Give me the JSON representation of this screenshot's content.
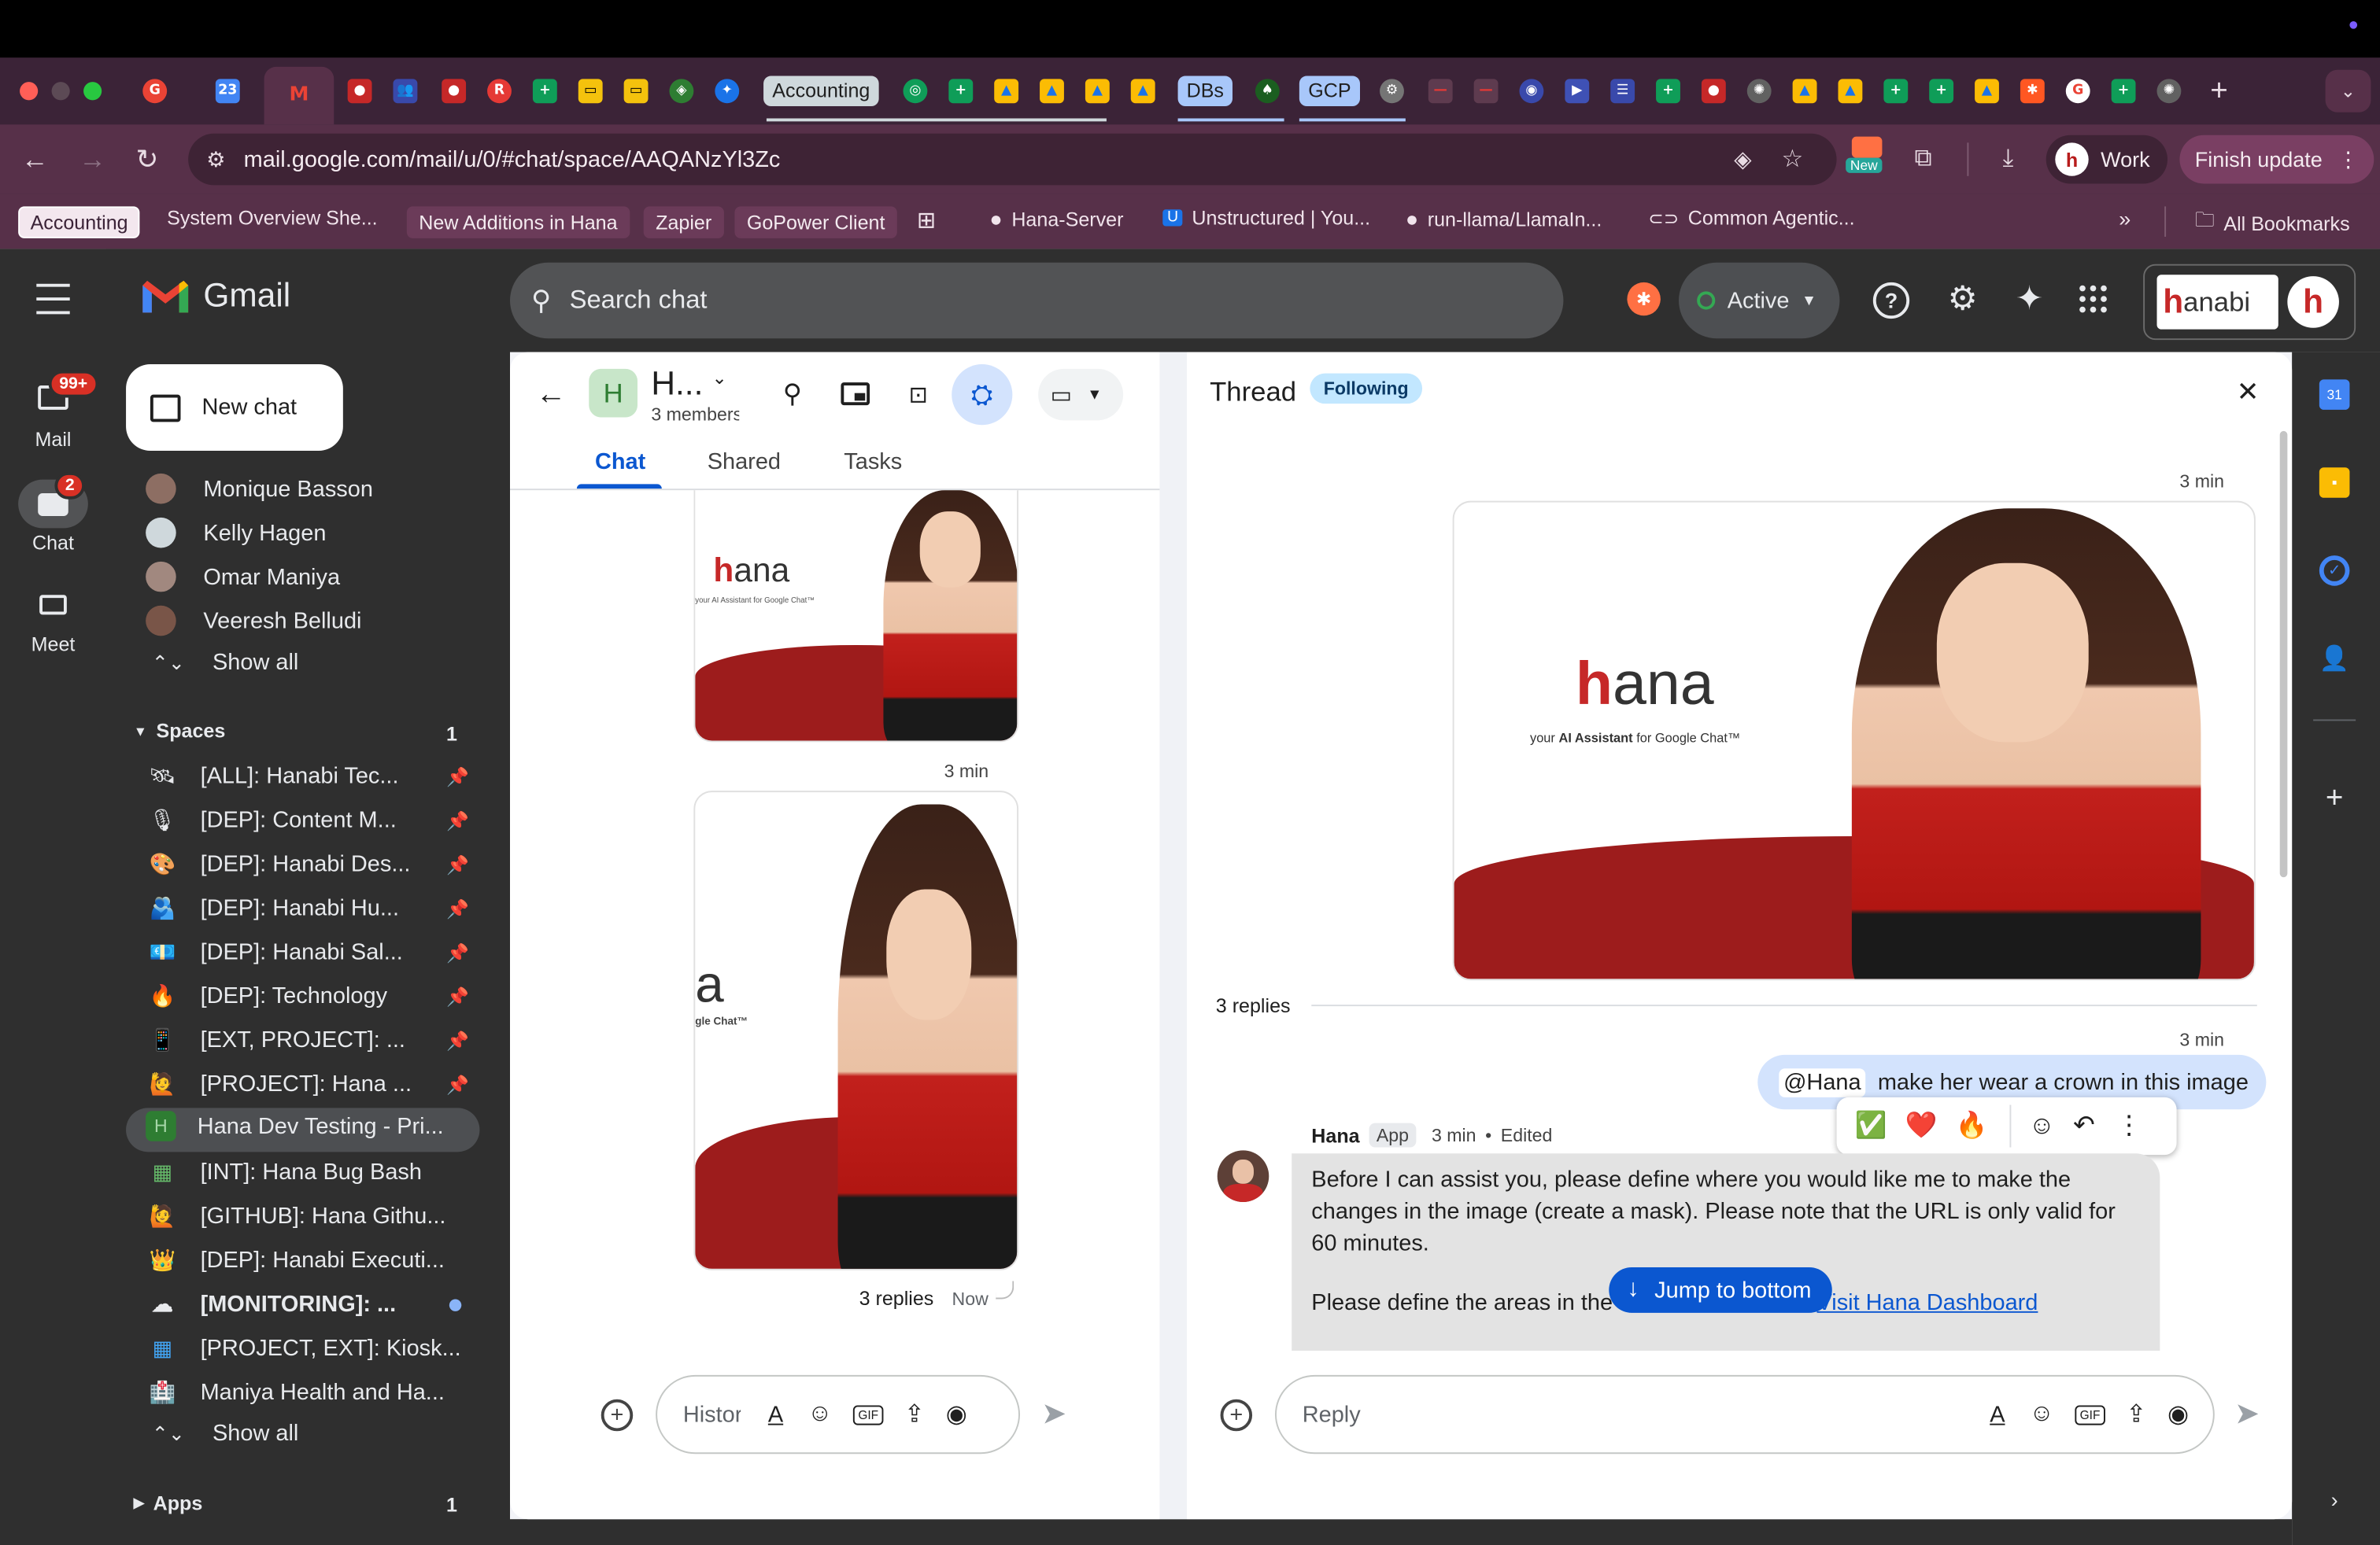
{
  "browser": {
    "tabs_text": [
      "Accounting",
      "DBs",
      "GCP"
    ],
    "url": "mail.google.com/mail/u/0/#chat/space/AAQANzYl3Zc",
    "new_badge": "New",
    "profile_label": "Work",
    "finish_update": "Finish update",
    "bookmarks": [
      "Accounting",
      "System Overview She...",
      "New Additions in Hana",
      "Zapier",
      "GoPower Client",
      "Hana-Server",
      "Unstructured | You...",
      "run-llama/LlamaIn...",
      "Common Agentic...",
      "All Bookmarks"
    ],
    "more": "»"
  },
  "gmail": {
    "logo_text": "Gmail",
    "search_placeholder": "Search chat",
    "status": "Active",
    "account_brand": "anabi",
    "rail": [
      {
        "label": "Mail",
        "badge": "99+"
      },
      {
        "label": "Chat",
        "badge": "2"
      },
      {
        "label": "Meet",
        "badge": ""
      }
    ],
    "new_chat": "New chat",
    "dms": [
      "Monique Basson",
      "Kelly Hagen",
      "Omar Maniya",
      "Veeresh Belludi"
    ],
    "show_all": "Show all",
    "spaces_header": "Spaces",
    "spaces_count": "1",
    "spaces": [
      {
        "icon": "🛰",
        "name": "[ALL]: Hanabi Tec...",
        "pinned": true
      },
      {
        "icon": "🎙",
        "name": "[DEP]: Content M...",
        "pinned": true
      },
      {
        "icon": "🎨",
        "name": "[DEP]: Hanabi Des...",
        "pinned": true
      },
      {
        "icon": "🫂",
        "name": "[DEP]: Hanabi Hu...",
        "pinned": true
      },
      {
        "icon": "💶",
        "name": "[DEP]: Hanabi Sal...",
        "pinned": true
      },
      {
        "icon": "🔥",
        "name": "[DEP]: Technology",
        "pinned": true
      },
      {
        "icon": "📱",
        "name": "[EXT, PROJECT]: ...",
        "pinned": true
      },
      {
        "icon": "🙋",
        "name": "[PROJECT]: Hana ...",
        "pinned": true
      },
      {
        "icon": "H",
        "name": "Hana Dev Testing - Pri...",
        "pinned": false
      },
      {
        "icon": "▦",
        "name": "[INT]: Hana Bug Bash",
        "pinned": false
      },
      {
        "icon": "🙋",
        "name": "[GITHUB]: Hana Githu...",
        "pinned": false
      },
      {
        "icon": "👑",
        "name": "[DEP]: Hanabi Executi...",
        "pinned": false
      },
      {
        "icon": "☁",
        "name": "[MONITORING]: ...",
        "pinned": false
      },
      {
        "icon": "▦",
        "name": "[PROJECT, EXT]: Kiosk...",
        "pinned": false
      },
      {
        "icon": "🏥",
        "name": "Maniya Health and Ha...",
        "pinned": false
      }
    ],
    "apps_header": "Apps",
    "apps_count": "1"
  },
  "space": {
    "avatar_letter": "H",
    "title": "H...",
    "members": "3 members",
    "tabs": [
      "Chat",
      "Shared",
      "Tasks"
    ],
    "active_tab": "Chat",
    "image_brand": "ana",
    "image_tagline": "your AI Assistant for Google Chat™",
    "image_time": "3 min",
    "image2_brand": "a",
    "image2_tagline": "gle Chat™",
    "replies": "3 replies",
    "replies_time": "Now",
    "composer_placeholder": "History is on"
  },
  "thread": {
    "title": "Thread",
    "following": "Following",
    "time1": "3 min",
    "image_brand": "ana",
    "image_tagline_prefix": "your",
    "image_tagline_bold": "AI Assistant",
    "image_tagline_suffix": "for Google Chat™",
    "replies": "3 replies",
    "time2": "3 min",
    "mention": "@Hana",
    "user_message": "make her wear a crown in this image",
    "reactions": [
      "✅",
      "❤️",
      "🔥"
    ],
    "sender": "Hana",
    "sender_tag": "App",
    "sender_time": "3 min",
    "edited": "Edited",
    "bot_text": "Before I can assist you, please define where you would like me to make the changes in the image (create a mask). Please note that the URL is only valid for 60 minutes.",
    "bot_text2": "Please define the areas in the",
    "bot_link": "Visit Hana Dashboard",
    "jump": "Jump to bottom",
    "reply_placeholder": "Reply"
  }
}
